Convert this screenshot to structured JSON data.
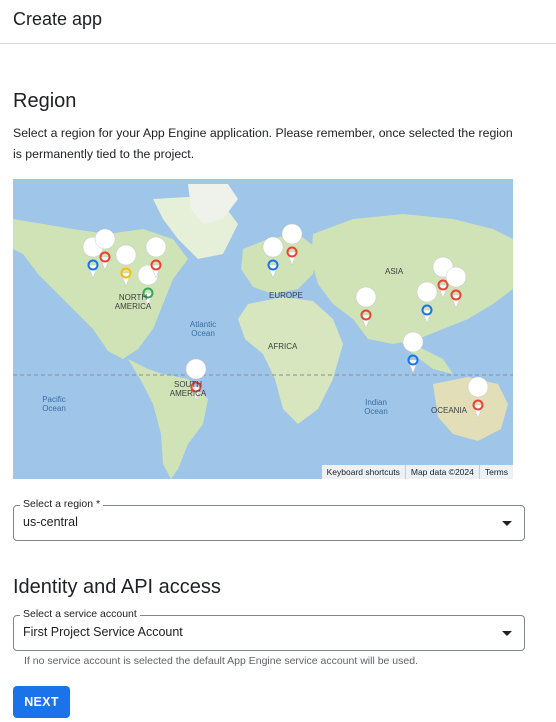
{
  "header": {
    "title": "Create app"
  },
  "region_section": {
    "heading": "Region",
    "description": "Select a region for your App Engine application. Please remember, once selected the region is permanently tied to the project."
  },
  "map": {
    "labels": {
      "asia": "ASIA",
      "north_america": "NORTH AMERICA",
      "europe": "EUROPE",
      "africa": "AFRICA",
      "south_america": "SOUTH AMERICA",
      "oceania": "OCEANIA",
      "atlantic_ocean": "Atlantic Ocean",
      "pacific_ocean": "Pacific Ocean",
      "indian_ocean": "Indian Ocean"
    },
    "attribution": {
      "shortcuts": "Keyboard shortcuts",
      "map_data": "Map data ©2024",
      "terms": "Terms"
    }
  },
  "region_select": {
    "label": "Select a region *",
    "value": "us-central"
  },
  "identity_section": {
    "heading": "Identity and API access"
  },
  "service_account_select": {
    "label": "Select a service account",
    "value": "First Project Service Account",
    "hint": "If no service account is selected the default App Engine service account will be used."
  },
  "actions": {
    "next_label": "NEXT"
  },
  "colors": {
    "accent": "#1a73e8",
    "water": "#9fc5e8",
    "land": "#cfe3b6",
    "marker": "#ffffff"
  }
}
